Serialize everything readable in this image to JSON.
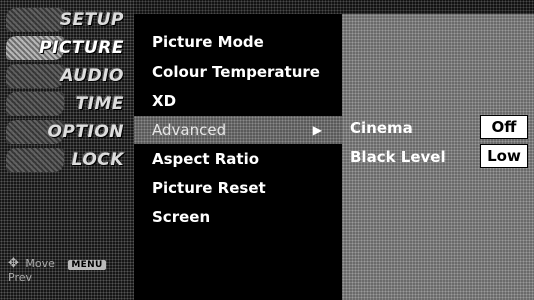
{
  "categories": [
    {
      "label": "SETUP",
      "active": false
    },
    {
      "label": "PICTURE",
      "active": true
    },
    {
      "label": "AUDIO",
      "active": false
    },
    {
      "label": "TIME",
      "active": false
    },
    {
      "label": "OPTION",
      "active": false
    },
    {
      "label": "LOCK",
      "active": false
    }
  ],
  "hints": {
    "move_label": "Move",
    "menu_key": "MENU",
    "prev_label": "Prev"
  },
  "picture_menu": {
    "items": [
      {
        "label": "Picture Mode",
        "selected": false
      },
      {
        "label": "Colour Temperature",
        "selected": false
      },
      {
        "label": "XD",
        "selected": false
      },
      {
        "label": "Advanced",
        "selected": true
      },
      {
        "label": "Aspect Ratio",
        "selected": false
      },
      {
        "label": "Picture Reset",
        "selected": false
      },
      {
        "label": "Screen",
        "selected": false
      }
    ]
  },
  "advanced_options": [
    {
      "label": "Cinema",
      "value": "Off"
    },
    {
      "label": "Black Level",
      "value": "Low"
    }
  ],
  "colors": {
    "selected_row": "#5a5a5a",
    "options_panel": "#6a6a6a",
    "value_box": "#ffffff"
  }
}
